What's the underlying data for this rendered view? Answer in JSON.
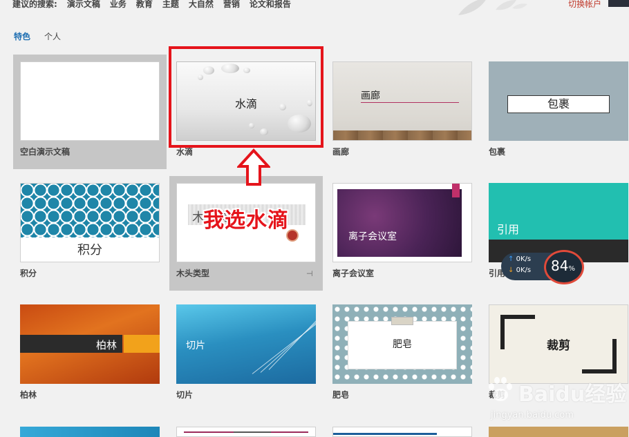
{
  "top": {
    "suggested_label": "建议的搜索:",
    "suggestions": [
      "演示文稿",
      "业务",
      "教育",
      "主题",
      "大自然",
      "营销",
      "论文和报告"
    ],
    "account": "切换帐户"
  },
  "tabs": {
    "featured": "特色",
    "personal": "个人"
  },
  "templates": {
    "blank": {
      "caption": "空白演示文稿"
    },
    "droplet": {
      "caption": "水滴",
      "title": "水滴"
    },
    "gallery": {
      "caption": "画廊",
      "title": "画廊"
    },
    "parcel": {
      "caption": "包裹",
      "title": "包裹"
    },
    "integral": {
      "caption": "积分",
      "title": "积分"
    },
    "wood": {
      "caption": "木头类型",
      "title": "木头类型"
    },
    "ion": {
      "caption": "离子会议室",
      "title": "离子会议室"
    },
    "quote": {
      "caption": "引用",
      "title": "引用"
    },
    "berlin": {
      "caption": "柏林",
      "title": "柏林"
    },
    "slice": {
      "caption": "切片",
      "title": "切片"
    },
    "soap": {
      "caption": "肥皂",
      "title": "肥皂"
    },
    "crop": {
      "caption": "裁剪",
      "title": "裁剪"
    }
  },
  "annotation": {
    "text": "我选水滴"
  },
  "speed_widget": {
    "up": "0K/s",
    "down": "0K/s",
    "percent": "84",
    "percent_sign": "%"
  },
  "watermark": {
    "logo": "Baidu经验",
    "url": "jingyan.baidu.com"
  },
  "colors": {
    "accent_blue": "#1f6fb2",
    "annotation_red": "#e5141b",
    "account_red": "#c0392b"
  }
}
